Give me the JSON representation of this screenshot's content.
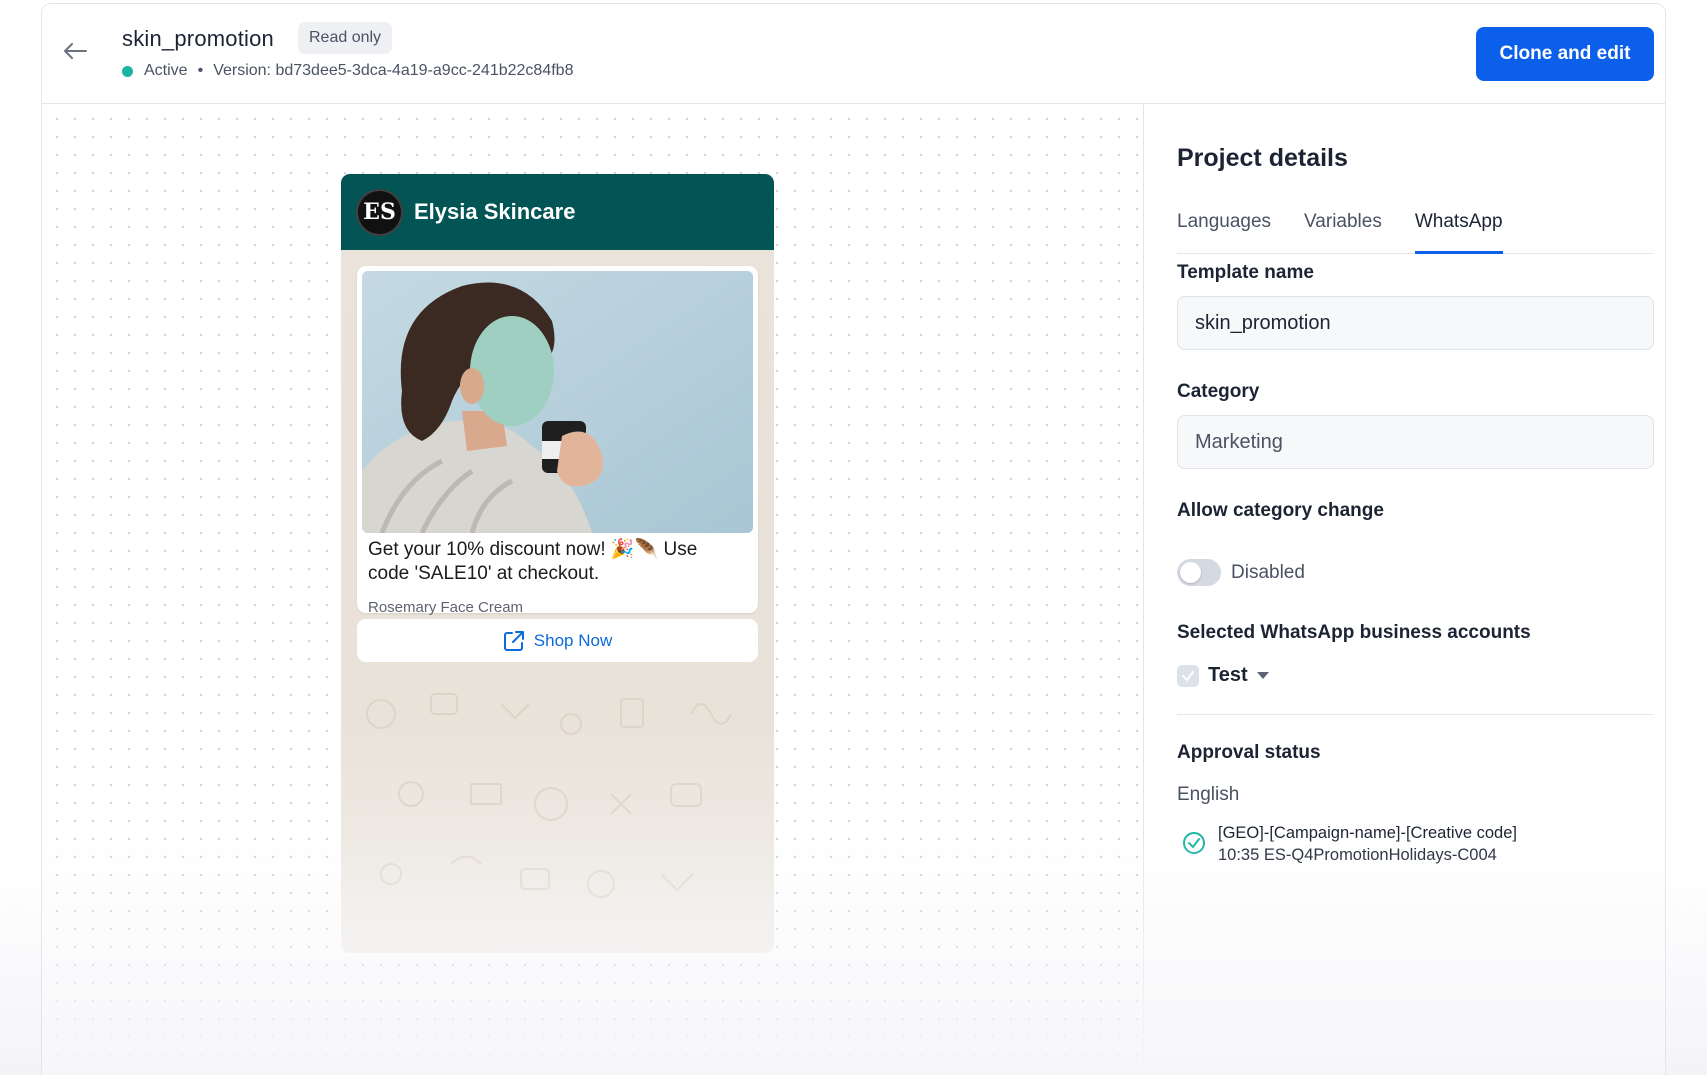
{
  "header": {
    "title": "skin_promotion",
    "badge": "Read only",
    "status": "Active",
    "separator": "•",
    "version": "Version: bd73dee5-3dca-4a19-a9cc-241b22c84fb8",
    "clone_button": "Clone and edit",
    "status_color": "#19b4a4",
    "accent_color": "#0b5fea"
  },
  "preview": {
    "business_name": "Elysia Skincare",
    "avatar_initials": "ES",
    "header_color": "#035454",
    "message_text": "Get your 10% discount now! 🎉🪶 Use code 'SALE10' at checkout.",
    "footer_text": "Rosemary Face Cream",
    "cta_label": "Shop Now",
    "cta_icon": "external-link-icon",
    "image": "woman-with-face-mask-holding-cream-jar"
  },
  "panel": {
    "title": "Project details",
    "tabs": [
      {
        "label": "Languages",
        "active": false
      },
      {
        "label": "Variables",
        "active": false
      },
      {
        "label": "WhatsApp",
        "active": true
      }
    ],
    "template_name_label": "Template name",
    "template_name_value": "skin_promotion",
    "category_label": "Category",
    "category_value": "Marketing",
    "allow_change_label": "Allow category change",
    "allow_change_state": "Disabled",
    "accounts_label": "Selected WhatsApp business accounts",
    "account_name": "Test",
    "approval_label": "Approval status",
    "approval_language": "English",
    "approval_line1": "[GEO]-[Campaign-name]-[Creative code]",
    "approval_line2": "10:35 ES-Q4PromotionHolidays-C004"
  }
}
